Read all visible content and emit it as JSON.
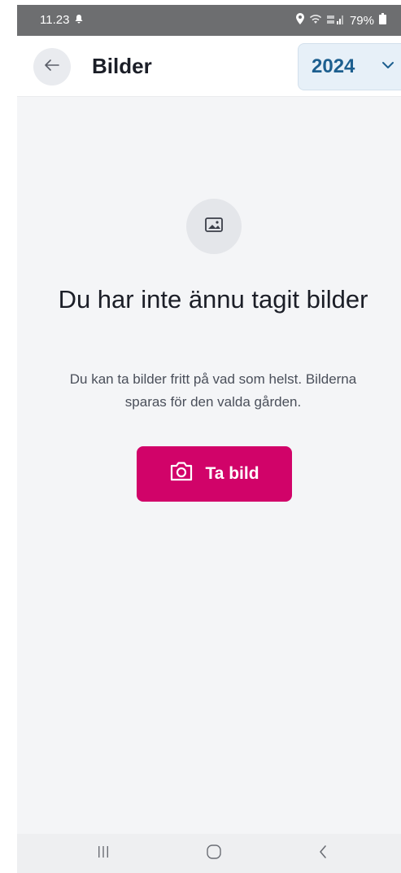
{
  "status_bar": {
    "time": "11.23",
    "battery": "79%"
  },
  "app_bar": {
    "title": "Bilder",
    "year_selected": "2024"
  },
  "empty_state": {
    "title": "Du har inte ännu tagit bilder",
    "description": "Du kan ta bilder fritt på vad som helst. Bilderna sparas för den valda gården."
  },
  "actions": {
    "take_photo_label": "Ta bild"
  },
  "colors": {
    "accent": "#d10369",
    "select_bg": "#e7f0f8",
    "select_text": "#1d5f8f",
    "background": "#f4f5f7",
    "status_bar": "#6d6e70"
  },
  "icons": {
    "back": "arrow-left-icon",
    "dropdown": "chevron-down-icon",
    "empty": "image-icon",
    "camera": "camera-icon",
    "nav_recents": "recent-apps-icon",
    "nav_home": "home-icon",
    "nav_back": "back-icon"
  }
}
